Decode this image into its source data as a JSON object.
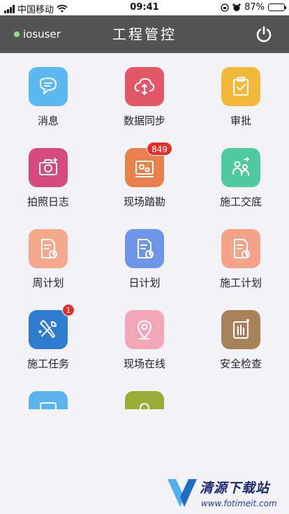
{
  "status": {
    "carrier": "中国移动",
    "time": "09:41",
    "battery": "87%",
    "battery_level": 0.87
  },
  "header": {
    "user": "iosuser",
    "title": "工程管控",
    "power_icon": "power-icon"
  },
  "tiles": [
    {
      "label": "消息",
      "icon": "chat-icon",
      "color": "#5bb8f0"
    },
    {
      "label": "数据同步",
      "icon": "cloud-sync-icon",
      "color": "#e25868"
    },
    {
      "label": "审批",
      "icon": "clipboard-check-icon",
      "color": "#f3b83a"
    },
    {
      "label": "拍照日志",
      "icon": "camera-icon",
      "color": "#d54a7f"
    },
    {
      "label": "现场踏勘",
      "icon": "survey-icon",
      "color": "#e8804c",
      "badge": "849"
    },
    {
      "label": "施工交底",
      "icon": "handover-icon",
      "color": "#4ec9a0"
    },
    {
      "label": "周计划",
      "icon": "plan-doc-icon",
      "color": "#f4a88c"
    },
    {
      "label": "日计划",
      "icon": "plan-doc-icon",
      "color": "#6f95e6"
    },
    {
      "label": "施工计划",
      "icon": "plan-doc-icon",
      "color": "#f3a388"
    },
    {
      "label": "施工任务",
      "icon": "tools-icon",
      "color": "#2f7bd0",
      "badge": "1"
    },
    {
      "label": "现场在线",
      "icon": "location-pin-icon",
      "color": "#f2a7b8"
    },
    {
      "label": "安全检查",
      "icon": "safety-check-icon",
      "color": "#a7825a"
    },
    {
      "label": "",
      "icon": "partial-blue-icon",
      "color": "#5cb2ec"
    },
    {
      "label": "",
      "icon": "partial-green-icon",
      "color": "#9bab38"
    }
  ],
  "watermark": {
    "title": "清源下载站",
    "url": "www.fotimeit.com"
  }
}
